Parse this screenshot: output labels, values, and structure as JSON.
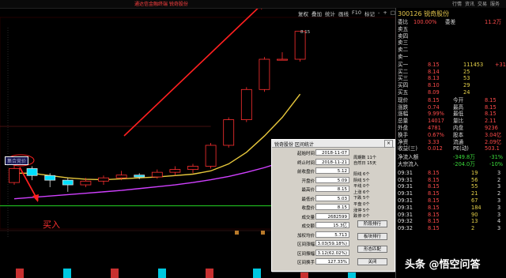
{
  "app": {
    "title": "通达信金融终端 锐奇股份"
  },
  "top_menu": [
    "行情",
    "资讯",
    "交易",
    "服务"
  ],
  "toolbar": [
    "复权",
    "叠加",
    "统计",
    "画线",
    "F10",
    "标记",
    "-",
    "+",
    "□"
  ],
  "chart": {
    "price_label": "8.15",
    "buy_badge": "集合竞价",
    "buy_label": "买入",
    "colors": {
      "up": "#ff3030",
      "down": "#00e0ff",
      "ma_yellow": "#e8c83c",
      "ma_magenta": "#d040ff",
      "support": "#20c020",
      "arrow": "#ff2020"
    },
    "candles": [
      {
        "o": 4.9,
        "c": 5.2,
        "h": 5.35,
        "l": 4.85
      },
      {
        "o": 5.2,
        "c": 5.05,
        "h": 5.25,
        "l": 4.95
      },
      {
        "o": 5.05,
        "c": 4.95,
        "h": 5.1,
        "l": 4.8
      },
      {
        "o": 4.95,
        "c": 4.85,
        "h": 5.0,
        "l": 4.7
      },
      {
        "o": 4.85,
        "c": 4.93,
        "h": 5.0,
        "l": 4.8
      },
      {
        "o": 4.93,
        "c": 5.0,
        "h": 5.05,
        "l": 4.85
      },
      {
        "o": 5.0,
        "c": 5.06,
        "h": 5.15,
        "l": 4.95
      },
      {
        "o": 5.06,
        "c": 5.02,
        "h": 5.1,
        "l": 4.97
      },
      {
        "o": 5.02,
        "c": 5.12,
        "h": 5.18,
        "l": 4.98
      },
      {
        "o": 5.12,
        "c": 5.18,
        "h": 5.25,
        "l": 5.05
      },
      {
        "o": 5.18,
        "c": 5.25,
        "h": 5.3,
        "l": 5.1
      },
      {
        "o": 5.25,
        "c": 5.7,
        "h": 5.75,
        "l": 5.2
      },
      {
        "o": 5.7,
        "c": 6.25,
        "h": 6.3,
        "l": 5.65
      },
      {
        "o": 6.25,
        "c": 6.9,
        "h": 6.95,
        "l": 6.2
      },
      {
        "o": 6.9,
        "c": 7.55,
        "h": 7.6,
        "l": 6.85
      },
      {
        "o": 7.55,
        "c": 7.55,
        "h": 7.7,
        "l": 7.55
      },
      {
        "o": 7.55,
        "c": 8.15,
        "h": 8.15,
        "l": 7.5
      }
    ],
    "ma_yellow": [
      5.1,
      5.1,
      5.05,
      5.0,
      4.97,
      4.96,
      4.98,
      5.0,
      5.02,
      5.05,
      5.08,
      5.15,
      5.3,
      5.55,
      5.9,
      6.3,
      6.8
    ],
    "ma_magenta": [
      4.55,
      4.58,
      4.61,
      4.64,
      4.67,
      4.7,
      4.73,
      4.77,
      4.81,
      4.85,
      4.9,
      4.96,
      5.03,
      5.12,
      5.22,
      5.34,
      5.48
    ],
    "support": 4.4
  },
  "right_panel": {
    "code": "300126",
    "name": "锐奇股份",
    "weibi_label": "委比",
    "weibi": "100.00%",
    "weicha_label": "委差",
    "weicha": "11.2万",
    "sell_rows": [
      {
        "label": "卖五",
        "price": "",
        "vol": ""
      },
      {
        "label": "卖四",
        "price": "",
        "vol": ""
      },
      {
        "label": "卖三",
        "price": "",
        "vol": ""
      },
      {
        "label": "卖二",
        "price": "",
        "vol": ""
      },
      {
        "label": "卖一",
        "price": "",
        "vol": ""
      }
    ],
    "buy_rows": [
      {
        "label": "买一",
        "price": "8.15",
        "vol": "111453",
        "chg": "+31"
      },
      {
        "label": "买二",
        "price": "8.14",
        "vol": "25",
        "": ""
      },
      {
        "label": "买三",
        "price": "8.13",
        "vol": "53"
      },
      {
        "label": "买四",
        "price": "8.10",
        "vol": "29"
      },
      {
        "label": "买五",
        "price": "8.09",
        "vol": "24"
      }
    ],
    "quote": [
      {
        "l1": "现价",
        "v1": "8.15",
        "l2": "今开",
        "v2": "8.15"
      },
      {
        "l1": "涨跌",
        "v1": "0.74",
        "l2": "最高",
        "v2": "8.15"
      },
      {
        "l1": "涨幅",
        "v1": "9.99%",
        "l2": "最低",
        "v2": "8.15"
      },
      {
        "l1": "总量",
        "v1": "14017",
        "l2": "量比",
        "v2": "2.11"
      },
      {
        "l1": "外盘",
        "v1": "4781",
        "l2": "内盘",
        "v2": "9236"
      },
      {
        "l1": "换手",
        "v1": "0.67%",
        "l2": "股本",
        "v2": "3.04亿"
      },
      {
        "l1": "净资",
        "v1": "3.33",
        "l2": "流通",
        "v2": "2.09亿"
      },
      {
        "l1": "收益(三)",
        "v1": "0.012",
        "l2": "PE(动)",
        "v2": "503.1"
      }
    ],
    "flow": [
      {
        "label": "净流入额",
        "v1": "-349.8万",
        "v2": "-31%"
      },
      {
        "label": "大宗流入",
        "v1": "-204.0万",
        "v2": "-10%"
      }
    ],
    "ticks": [
      {
        "t": "09:31",
        "p": "8.15",
        "v": "19",
        "s": "3"
      },
      {
        "t": "09:31",
        "p": "8.15",
        "v": "56",
        "s": "2"
      },
      {
        "t": "09:31",
        "p": "8.15",
        "v": "55",
        "s": "3"
      },
      {
        "t": "09:31",
        "p": "8.15",
        "v": "21",
        "s": "2"
      },
      {
        "t": "09:31",
        "p": "8.15",
        "v": "67",
        "s": "3"
      },
      {
        "t": "09:31",
        "p": "8.15",
        "v": "184",
        "s": "3"
      },
      {
        "t": "09:31",
        "p": "8.15",
        "v": "90",
        "s": "3"
      },
      {
        "t": "09:32",
        "p": "8.15",
        "v": "13",
        "s": "4"
      },
      {
        "t": "09:32",
        "p": "8.15",
        "v": "2",
        "s": "3"
      }
    ]
  },
  "dialog": {
    "title": "锐奇股份 区间统计",
    "close": "×",
    "fields": [
      {
        "label": "起始时间",
        "value": "2018-11-07"
      },
      {
        "label": "终止时间",
        "value": "2018-11-21"
      },
      {
        "label": "前收盘价",
        "value": "5.12"
      },
      {
        "label": "开盘价",
        "value": "5.09"
      },
      {
        "label": "最高价",
        "value": "8.15"
      },
      {
        "label": "最低价",
        "value": "5.03"
      },
      {
        "label": "收盘价",
        "value": "8.15"
      },
      {
        "label": "成交量",
        "value": "2682599"
      },
      {
        "label": "成交额",
        "value": "15.3亿"
      },
      {
        "label": "加权均价",
        "value": "5.713"
      },
      {
        "label": "区间涨幅",
        "value": "3.03(59.18%)"
      },
      {
        "label": "区间振幅",
        "value": "3.12(62.02%)"
      },
      {
        "label": "区间换手",
        "value": "127.33%"
      }
    ],
    "period": [
      "周期数 11个",
      "自然日 15天"
    ],
    "stats": [
      "阳线 6个",
      "阴线 5个",
      "平线 0个",
      "上涨 6个",
      "下跌 5个",
      "平盘 0个",
      "涨停 5个",
      "跌停 0个"
    ],
    "buttons": [
      "阶段排行",
      "板块排行",
      "形态匹配",
      "关闭"
    ]
  },
  "watermark": "头条 @悟空问答"
}
